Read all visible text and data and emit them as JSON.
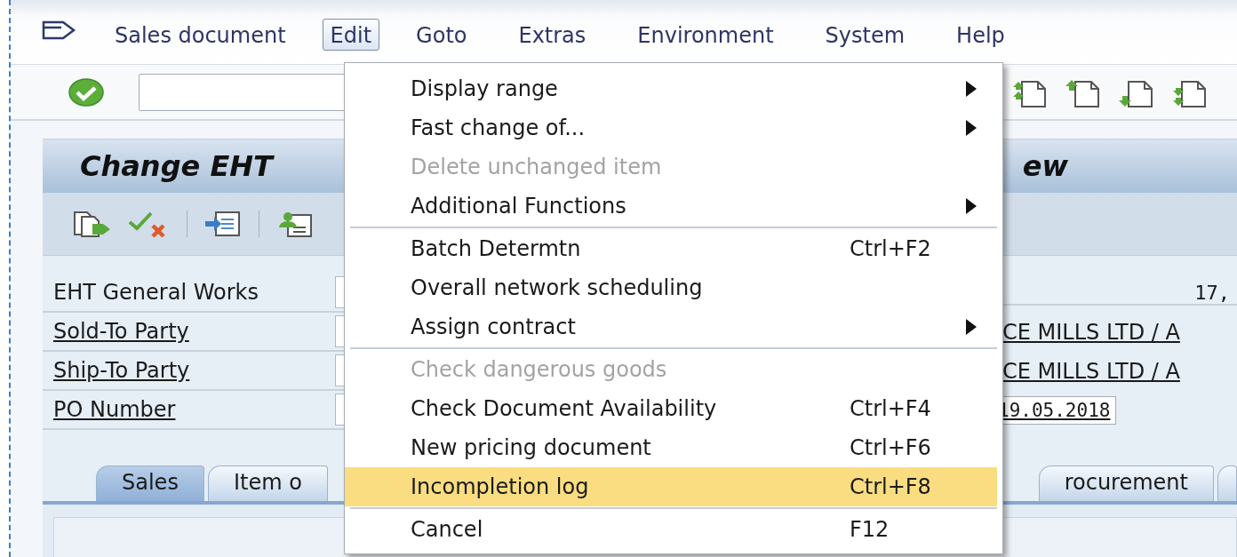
{
  "menu_bar": {
    "items": [
      {
        "label": "Sales document",
        "selected": false
      },
      {
        "label": "Edit",
        "selected": true
      },
      {
        "label": "Goto",
        "selected": false
      },
      {
        "label": "Extras",
        "selected": false
      },
      {
        "label": "Environment",
        "selected": false
      },
      {
        "label": "System",
        "selected": false
      },
      {
        "label": "Help",
        "selected": false
      }
    ]
  },
  "screen_title": {
    "start": "Change EHT",
    "end": "ew"
  },
  "header_fields": [
    {
      "label": "EHT General Works",
      "label_link": false,
      "kind": "amount",
      "value": "17,"
    },
    {
      "label": "Sold-To Party",
      "label_link": true,
      "kind": "partner",
      "value": "CE MILLS LTD / A"
    },
    {
      "label": "Ship-To Party",
      "label_link": true,
      "kind": "partner",
      "value": "CE MILLS LTD / A"
    },
    {
      "label": "PO Number",
      "label_link": true,
      "kind": "date",
      "value": "19.05.2018"
    }
  ],
  "tabs_left": [
    {
      "label": "Sales",
      "selected": true
    },
    {
      "label": "Item o",
      "selected": false
    }
  ],
  "tabs_right": [
    {
      "label": "rocurement",
      "selected": false
    }
  ],
  "edit_menu": {
    "groups": [
      [
        {
          "label": "Display range",
          "submenu": true,
          "disabled": false,
          "selected": false
        },
        {
          "label": "Fast change of...",
          "submenu": true,
          "disabled": false,
          "selected": false
        },
        {
          "label": "Delete unchanged item",
          "submenu": false,
          "disabled": true,
          "selected": false
        },
        {
          "label": "Additional Functions",
          "submenu": true,
          "disabled": false,
          "selected": false
        }
      ],
      [
        {
          "label": "Batch Determtn",
          "shortcut": "Ctrl+F2",
          "submenu": false,
          "disabled": false,
          "selected": false
        },
        {
          "label": "Overall network scheduling",
          "submenu": false,
          "disabled": false,
          "selected": false
        },
        {
          "label": "Assign contract",
          "submenu": true,
          "disabled": false,
          "selected": false
        }
      ],
      [
        {
          "label": "Check dangerous goods",
          "submenu": false,
          "disabled": true,
          "selected": false
        },
        {
          "label": "Check Document Availability",
          "shortcut": "Ctrl+F4",
          "submenu": false,
          "disabled": false,
          "selected": false
        },
        {
          "label": "New pricing document",
          "shortcut": "Ctrl+F6",
          "submenu": false,
          "disabled": false,
          "selected": false
        },
        {
          "label": "Incompletion log",
          "shortcut": "Ctrl+F8",
          "submenu": false,
          "disabled": false,
          "selected": true
        }
      ],
      [
        {
          "label": "Cancel",
          "shortcut": "F12",
          "submenu": false,
          "disabled": false,
          "selected": false
        }
      ]
    ]
  }
}
